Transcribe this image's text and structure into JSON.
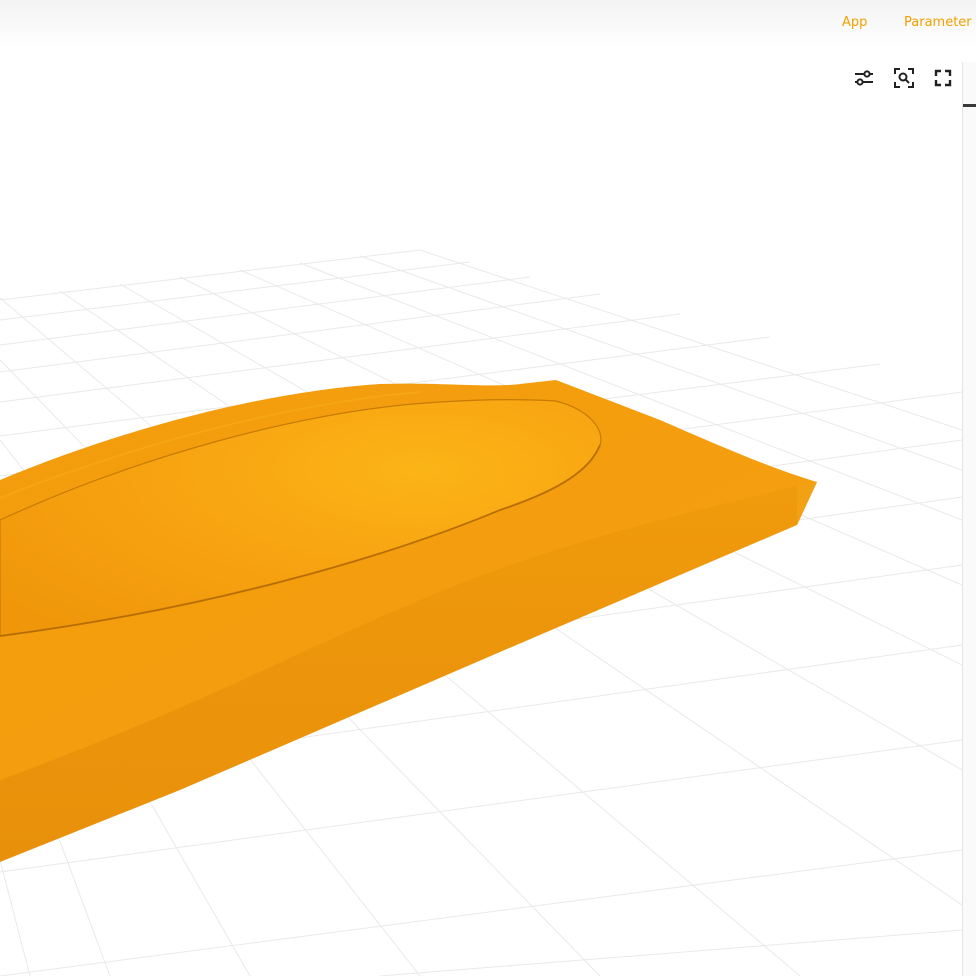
{
  "nav": {
    "app_label": "App",
    "parameters_label": "Parameter C"
  },
  "viewport": {
    "model_color": "#f59d0a",
    "grid_color": "#e6e6e6"
  },
  "toolbar": {
    "settings_icon": "sliders-icon",
    "zoom_icon": "zoom-to-fit-icon",
    "fullscreen_icon": "fullscreen-icon"
  }
}
